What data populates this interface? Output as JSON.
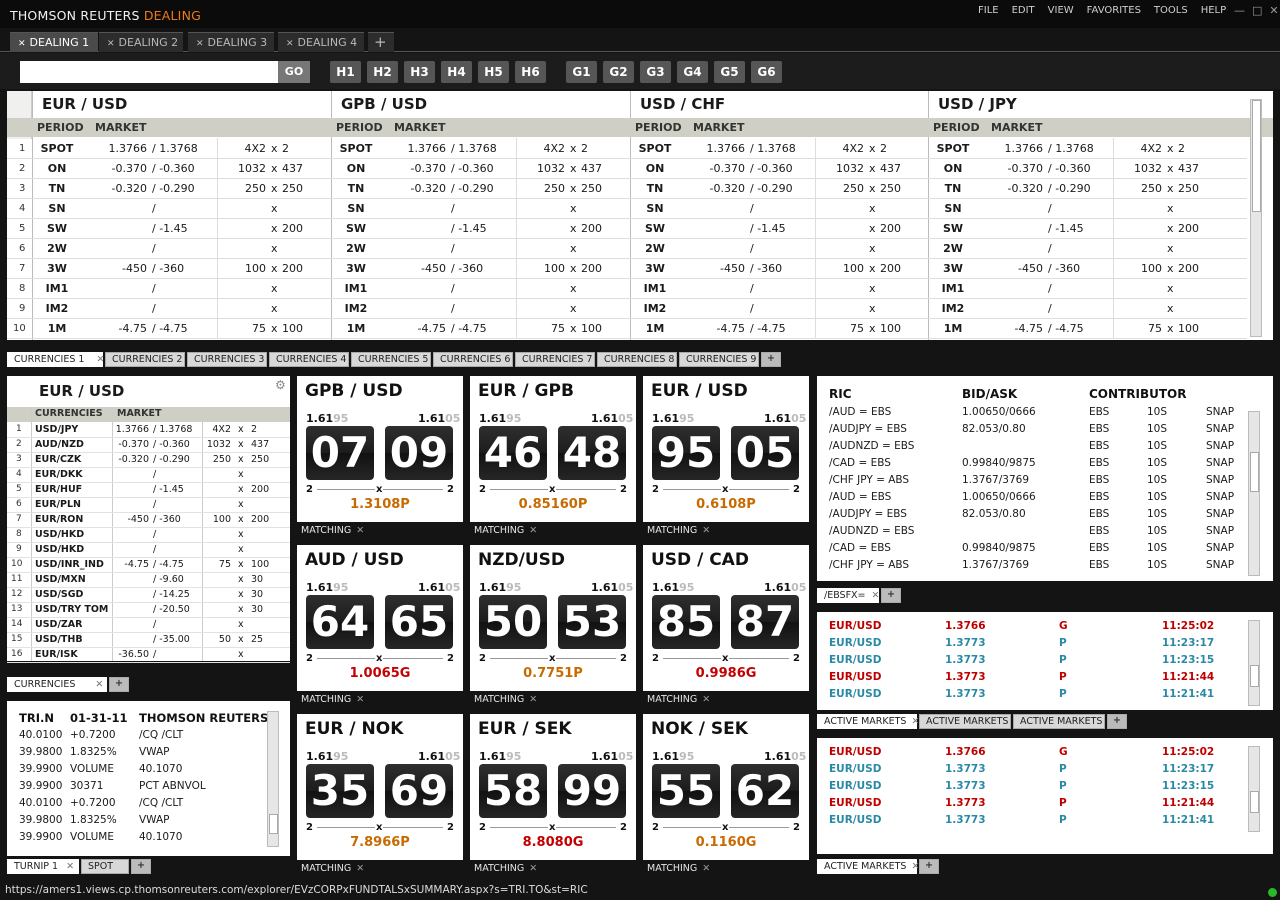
{
  "app": {
    "brand_main": "THOMSON REUTERS",
    "brand_accent": "DEALING",
    "menu": [
      "FILE",
      "EDIT",
      "VIEW",
      "FAVORITES",
      "TOOLS",
      "HELP"
    ],
    "tabs": [
      "DEALING 1",
      "DEALING 2",
      "DEALING 3",
      "DEALING 4"
    ],
    "go_label": "GO",
    "hbuttons": [
      "H1",
      "H2",
      "H3",
      "H4",
      "H5",
      "H6"
    ],
    "gbuttons": [
      "G1",
      "G2",
      "G3",
      "G4",
      "G5",
      "G6"
    ],
    "status_url": "https://amers1.views.cp.thomsonreuters.com/explorer/EVzCORPxFUNDTALSxSUMMARY.aspx?s=TRI.TO&st=RIC"
  },
  "top_grid": {
    "pairs": [
      "EUR / USD",
      "GPB / USD",
      "USD / CHF",
      "USD / JPY"
    ],
    "col_period": "PERIOD",
    "col_market": "MARKET",
    "rows": [
      {
        "n": "1",
        "p": "SPOT",
        "bid": "1.3766",
        "ask": "/ 1.3768",
        "s1": "4X2",
        "s2": "2"
      },
      {
        "n": "2",
        "p": "ON",
        "bid": "-0.370",
        "ask": "/ -0.360",
        "s1": "1032",
        "s2": "437"
      },
      {
        "n": "3",
        "p": "TN",
        "bid": "-0.320",
        "ask": "/ -0.290",
        "s1": "250",
        "s2": "250"
      },
      {
        "n": "4",
        "p": "SN",
        "bid": "",
        "ask": "/",
        "s1": "",
        "s2": ""
      },
      {
        "n": "5",
        "p": "SW",
        "bid": "",
        "ask": "/ -1.45",
        "s1": "",
        "s2": "200"
      },
      {
        "n": "6",
        "p": "2W",
        "bid": "",
        "ask": "/",
        "s1": "",
        "s2": ""
      },
      {
        "n": "7",
        "p": "3W",
        "bid": "-450",
        "ask": "/ -360",
        "s1": "100",
        "s2": "200"
      },
      {
        "n": "8",
        "p": "IM1",
        "bid": "",
        "ask": "/",
        "s1": "",
        "s2": ""
      },
      {
        "n": "9",
        "p": "IM2",
        "bid": "",
        "ask": "/",
        "s1": "",
        "s2": ""
      },
      {
        "n": "10",
        "p": "1M",
        "bid": "-4.75",
        "ask": "/ -4.75",
        "s1": "75",
        "s2": "100"
      }
    ],
    "tabs": [
      "CURRENCIES 1",
      "CURRENCIES 2",
      "CURRENCIES 3",
      "CURRENCIES 4",
      "CURRENCIES 5",
      "CURRENCIES 6",
      "CURRENCIES 7",
      "CURRENCIES 8",
      "CURRENCIES 9"
    ]
  },
  "small_grid": {
    "title": "EUR / USD",
    "col_cur": "CURRENCIES",
    "col_market": "MARKET",
    "tab": "CURRENCIES",
    "rows": [
      {
        "n": "1",
        "c": "USD/JPY",
        "bid": "1.3766",
        "ask": "/ 1.3768",
        "s1": "4X2",
        "x": "x",
        "s2": "2"
      },
      {
        "n": "2",
        "c": "AUD/NZD",
        "bid": "-0.370",
        "ask": "/ -0.360",
        "s1": "1032",
        "x": "x",
        "s2": "437"
      },
      {
        "n": "3",
        "c": "EUR/CZK",
        "bid": "-0.320",
        "ask": "/ -0.290",
        "s1": "250",
        "x": "x",
        "s2": "250"
      },
      {
        "n": "4",
        "c": "EUR/DKK",
        "bid": "",
        "ask": "/",
        "s1": "",
        "x": "x",
        "s2": ""
      },
      {
        "n": "5",
        "c": "EUR/HUF",
        "bid": "",
        "ask": "/ -1.45",
        "s1": "",
        "x": "x",
        "s2": "200"
      },
      {
        "n": "6",
        "c": "EUR/PLN",
        "bid": "",
        "ask": "/",
        "s1": "",
        "x": "x",
        "s2": ""
      },
      {
        "n": "7",
        "c": "EUR/RON",
        "bid": "-450",
        "ask": "/ -360",
        "s1": "100",
        "x": "x",
        "s2": "200"
      },
      {
        "n": "8",
        "c": "USD/HKD",
        "bid": "",
        "ask": "/",
        "s1": "",
        "x": "x",
        "s2": ""
      },
      {
        "n": "9",
        "c": "USD/HKD",
        "bid": "",
        "ask": "/",
        "s1": "",
        "x": "x",
        "s2": ""
      },
      {
        "n": "10",
        "c": "USD/INR_IND",
        "bid": "-4.75",
        "ask": "/ -4.75",
        "s1": "75",
        "x": "x",
        "s2": "100"
      },
      {
        "n": "11",
        "c": "USD/MXN",
        "bid": "",
        "ask": "/ -9.60",
        "s1": "",
        "x": "x",
        "s2": "30"
      },
      {
        "n": "12",
        "c": "USD/SGD",
        "bid": "",
        "ask": "/ -14.25",
        "s1": "",
        "x": "x",
        "s2": "30"
      },
      {
        "n": "13",
        "c": "USD/TRY TOM",
        "bid": "",
        "ask": "/ -20.50",
        "s1": "",
        "x": "x",
        "s2": "30"
      },
      {
        "n": "14",
        "c": "USD/ZAR",
        "bid": "",
        "ask": "/",
        "s1": "",
        "x": "x",
        "s2": ""
      },
      {
        "n": "15",
        "c": "USD/THB",
        "bid": "",
        "ask": "/ -35.00",
        "s1": "50",
        "x": "x",
        "s2": "25"
      },
      {
        "n": "16",
        "c": "EUR/ISK",
        "bid": "-36.50",
        "ask": "/",
        "s1": "",
        "x": "x",
        "s2": ""
      }
    ]
  },
  "quote": {
    "h1": "TRI.N",
    "h2": "01-31-11",
    "h3": "THOMSON REUTERS",
    "tab1": "TURNIP 1",
    "tab2": "SPOT",
    "rows": [
      [
        "40.0100",
        "+0.7200",
        "/CQ /CLT"
      ],
      [
        "39.9800",
        "1.8325%",
        "VWAP"
      ],
      [
        "39.9900",
        "VOLUME",
        "40.1070"
      ],
      [
        "39.9900",
        "30371",
        "PCT ABNVOL"
      ],
      [
        "40.0100",
        "+0.7200",
        "/CQ /CLT"
      ],
      [
        "39.9800",
        "1.8325%",
        "VWAP"
      ],
      [
        "39.9900",
        "VOLUME",
        "40.1070"
      ]
    ]
  },
  "tiles": [
    {
      "pair": "GPB / USD",
      "big": "1.61",
      "bs": "95",
      "ab": "1.61",
      "as": "05",
      "d1": "07",
      "d2": "09",
      "q1": "2",
      "qx": "x",
      "q2": "2",
      "last": "1.3108P",
      "lc": "#c86a00"
    },
    {
      "pair": "EUR / GPB",
      "big": "1.61",
      "bs": "95",
      "ab": "1.61",
      "as": "05",
      "d1": "46",
      "d2": "48",
      "q1": "2",
      "qx": "x",
      "q2": "2",
      "last": "0.85160P",
      "lc": "#c86a00"
    },
    {
      "pair": "EUR / USD",
      "big": "1.61",
      "bs": "95",
      "ab": "1.61",
      "as": "05",
      "d1": "95",
      "d2": "05",
      "q1": "2",
      "qx": "x",
      "q2": "2",
      "last": "0.6108P",
      "lc": "#c86a00"
    },
    {
      "pair": "AUD / USD",
      "big": "1.61",
      "bs": "95",
      "ab": "1.61",
      "as": "05",
      "d1": "64",
      "d2": "65",
      "q1": "2",
      "qx": "x",
      "q2": "2",
      "last": "1.0065G",
      "lc": "#c40000"
    },
    {
      "pair": "NZD/USD",
      "big": "1.61",
      "bs": "95",
      "ab": "1.61",
      "as": "05",
      "d1": "50",
      "d2": "53",
      "q1": "2",
      "qx": "x",
      "q2": "2",
      "last": "0.7751P",
      "lc": "#c86a00"
    },
    {
      "pair": "USD / CAD",
      "big": "1.61",
      "bs": "95",
      "ab": "1.61",
      "as": "05",
      "d1": "85",
      "d2": "87",
      "q1": "2",
      "qx": "x",
      "q2": "2",
      "last": "0.9986G",
      "lc": "#c40000"
    },
    {
      "pair": "EUR / NOK",
      "big": "1.61",
      "bs": "95",
      "ab": "1.61",
      "as": "05",
      "d1": "35",
      "d2": "69",
      "q1": "2",
      "qx": "x",
      "q2": "2",
      "last": "7.8966P",
      "lc": "#c86a00"
    },
    {
      "pair": "EUR / SEK",
      "big": "1.61",
      "bs": "95",
      "ab": "1.61",
      "as": "05",
      "d1": "58",
      "d2": "99",
      "q1": "2",
      "qx": "x",
      "q2": "2",
      "last": "8.8080G",
      "lc": "#c40000"
    },
    {
      "pair": "NOK / SEK",
      "big": "1.61",
      "bs": "95",
      "ab": "1.61",
      "as": "05",
      "d1": "55",
      "d2": "62",
      "q1": "2",
      "qx": "x",
      "q2": "2",
      "last": "0.1160G",
      "lc": "#c86a00"
    }
  ],
  "tile_tab": "MATCHING",
  "ric": {
    "h1": "RIC",
    "h2": "BID/ASK",
    "h3": "CONTRIBUTOR",
    "tab": "/EBSFX=",
    "rows": [
      [
        "/AUD = EBS",
        "1.00650/0666",
        "EBS",
        "10S",
        "SNAP"
      ],
      [
        "/AUDJPY = EBS",
        "82.053/0.80",
        "EBS",
        "10S",
        "SNAP"
      ],
      [
        "/AUDNZD = EBS",
        "",
        "EBS",
        "10S",
        "SNAP"
      ],
      [
        "/CAD = EBS",
        "0.99840/9875",
        "EBS",
        "10S",
        "SNAP"
      ],
      [
        "/CHF JPY = ABS",
        "1.3767/3769",
        "EBS",
        "10S",
        "SNAP"
      ],
      [
        "/AUD = EBS",
        "1.00650/0666",
        "EBS",
        "10S",
        "SNAP"
      ],
      [
        "/AUDJPY = EBS",
        "82.053/0.80",
        "EBS",
        "10S",
        "SNAP"
      ],
      [
        "/AUDNZD = EBS",
        "",
        "EBS",
        "10S",
        "SNAP"
      ],
      [
        "/CAD = EBS",
        "0.99840/9875",
        "EBS",
        "10S",
        "SNAP"
      ],
      [
        "/CHF JPY = ABS",
        "1.3767/3769",
        "EBS",
        "10S",
        "SNAP"
      ]
    ]
  },
  "active1": {
    "tabs": [
      "ACTIVE MARKETS",
      "ACTIVE MARKETS",
      "ACTIVE MARKETS"
    ],
    "rows": [
      {
        "pair": "EUR/USD",
        "px": "1.3766",
        "s": "G",
        "t": "11:25:02",
        "c": "#c00000"
      },
      {
        "pair": "EUR/USD",
        "px": "1.3773",
        "s": "P",
        "t": "11:23:17",
        "c": "#2a8aa6"
      },
      {
        "pair": "EUR/USD",
        "px": "1.3773",
        "s": "P",
        "t": "11:23:15",
        "c": "#2a8aa6"
      },
      {
        "pair": "EUR/USD",
        "px": "1.3773",
        "s": "P",
        "t": "11:21:44",
        "c": "#c00000"
      },
      {
        "pair": "EUR/USD",
        "px": "1.3773",
        "s": "P",
        "t": "11:21:41",
        "c": "#2a8aa6"
      }
    ]
  },
  "active2": {
    "tab": "ACTIVE MARKETS",
    "rows": [
      {
        "pair": "EUR/USD",
        "px": "1.3766",
        "s": "G",
        "t": "11:25:02",
        "c": "#c00000"
      },
      {
        "pair": "EUR/USD",
        "px": "1.3773",
        "s": "P",
        "t": "11:23:17",
        "c": "#2a8aa6"
      },
      {
        "pair": "EUR/USD",
        "px": "1.3773",
        "s": "P",
        "t": "11:23:15",
        "c": "#2a8aa6"
      },
      {
        "pair": "EUR/USD",
        "px": "1.3773",
        "s": "P",
        "t": "11:21:44",
        "c": "#c00000"
      },
      {
        "pair": "EUR/USD",
        "px": "1.3773",
        "s": "P",
        "t": "11:21:41",
        "c": "#2a8aa6"
      }
    ]
  }
}
